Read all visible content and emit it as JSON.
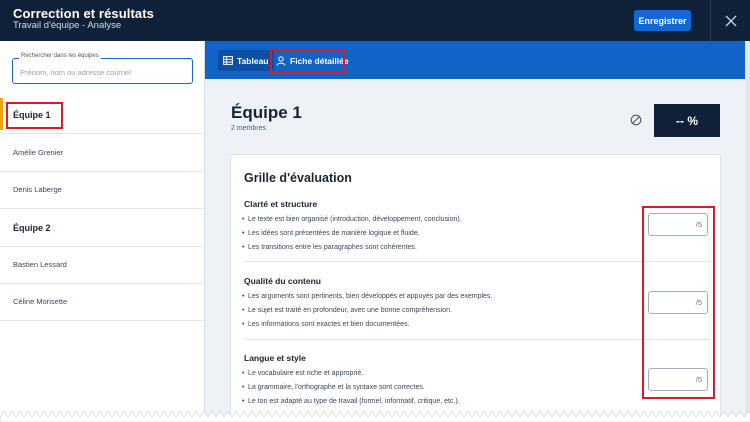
{
  "header": {
    "title": "Correction et résultats",
    "subtitle": "Travail d'équipe - Analyse",
    "save_label": "Enregistrer",
    "close_icon": "close-icon",
    "background": "#0f2139",
    "accent": "#1168d6"
  },
  "sidebar": {
    "search": {
      "legend": "Rechercher dans les équipes",
      "placeholder": "Prénom, nom ou adresse courriel",
      "value": ""
    },
    "teams": [
      {
        "name": "Équipe 1",
        "selected": true,
        "members": [
          "Amélie Grenier",
          "Denis Laberge"
        ]
      },
      {
        "name": "Équipe 2",
        "selected": false,
        "members": [
          "Bastien Lessard",
          "Céline Morisette"
        ]
      }
    ],
    "active_color": "#f0a500"
  },
  "tabs": [
    {
      "label": "Tableau",
      "icon": "table-icon",
      "active": true
    },
    {
      "label": "Fiche détaillée",
      "icon": "user-icon",
      "active": false
    }
  ],
  "team_header": {
    "name": "Équipe 1",
    "members_count": "2 membres",
    "status_icon": "no-entry-icon",
    "score": "-- %"
  },
  "grid": {
    "title": "Grille d'évaluation",
    "criteria": [
      {
        "title": "Clarté et structure",
        "bullets": [
          "Le texte est bien organisé (introduction, développement, conclusion).",
          "Les idées sont présentées de manière logique et fluide.",
          "Les transitions entre les paragraphes sont cohérentes."
        ],
        "score_value": "",
        "score_suffix": "/5"
      },
      {
        "title": "Qualité du contenu",
        "bullets": [
          "Les arguments sont pertinents, bien développés et appuyés par des exemples.",
          "Le sujet est traité en profondeur, avec une bonne compréhension.",
          "Les informations sont exactes et bien documentées."
        ],
        "score_value": "",
        "score_suffix": "/5"
      },
      {
        "title": "Langue et style",
        "bullets": [
          "Le vocabulaire est riche et approprié.",
          "La grammaire, l'orthographe et la syntaxe sont correctes.",
          "Le ton est adapté au type de travail (formel, informatif, critique, etc.)."
        ],
        "score_value": "",
        "score_suffix": "/5"
      }
    ]
  },
  "highlight_color": "#d81b2c"
}
